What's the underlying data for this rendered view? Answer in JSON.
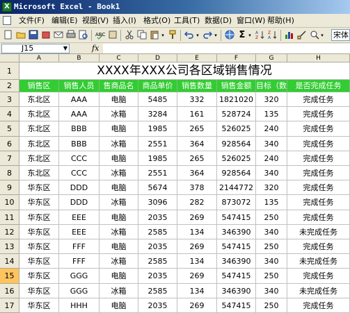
{
  "window": {
    "title": "Microsoft Excel - Book1"
  },
  "menu": [
    "文件(F)",
    "编辑(E)",
    "视图(V)",
    "插入(I)",
    "格式(O)",
    "工具(T)",
    "数据(D)",
    "窗口(W)",
    "帮助(H)"
  ],
  "toolbar": {
    "font_name": "宋体",
    "fx_label": "fx"
  },
  "formula_bar": {
    "name_box": "J15",
    "formula": ""
  },
  "columns": [
    "A",
    "B",
    "C",
    "D",
    "E",
    "F",
    "G",
    "H"
  ],
  "row_numbers": [
    "1",
    "2",
    "3",
    "4",
    "5",
    "6",
    "7",
    "8",
    "9",
    "10",
    "11",
    "12",
    "13",
    "14",
    "15",
    "16",
    "17"
  ],
  "sheet": {
    "title": "XXXX年XXX公司各区域销售情况",
    "headers": [
      "销售区",
      "销售人员",
      "售商品名",
      "商品单价",
      "销售数量",
      "销售金额",
      "目标（数",
      "是否完成任务"
    ],
    "rows": [
      [
        "东北区",
        "AAA",
        "电脑",
        "5485",
        "332",
        "1821020",
        "320",
        "完成任务"
      ],
      [
        "东北区",
        "AAA",
        "冰箱",
        "3284",
        "161",
        "528724",
        "135",
        "完成任务"
      ],
      [
        "东北区",
        "BBB",
        "电脑",
        "1985",
        "265",
        "526025",
        "240",
        "完成任务"
      ],
      [
        "东北区",
        "BBB",
        "冰箱",
        "2551",
        "364",
        "928564",
        "340",
        "完成任务"
      ],
      [
        "东北区",
        "CCC",
        "电脑",
        "1985",
        "265",
        "526025",
        "240",
        "完成任务"
      ],
      [
        "东北区",
        "CCC",
        "冰箱",
        "2551",
        "364",
        "928564",
        "340",
        "完成任务"
      ],
      [
        "华东区",
        "DDD",
        "电脑",
        "5674",
        "378",
        "2144772",
        "320",
        "完成任务"
      ],
      [
        "华东区",
        "DDD",
        "冰箱",
        "3096",
        "282",
        "873072",
        "135",
        "完成任务"
      ],
      [
        "华东区",
        "EEE",
        "电脑",
        "2035",
        "269",
        "547415",
        "250",
        "完成任务"
      ],
      [
        "华东区",
        "EEE",
        "冰箱",
        "2585",
        "134",
        "346390",
        "340",
        "未完成任务"
      ],
      [
        "华东区",
        "FFF",
        "电脑",
        "2035",
        "269",
        "547415",
        "250",
        "完成任务"
      ],
      [
        "华东区",
        "FFF",
        "冰箱",
        "2585",
        "134",
        "346390",
        "340",
        "未完成任务"
      ],
      [
        "华东区",
        "GGG",
        "电脑",
        "2035",
        "269",
        "547415",
        "250",
        "完成任务"
      ],
      [
        "华东区",
        "GGG",
        "冰箱",
        "2585",
        "134",
        "346390",
        "340",
        "未完成任务"
      ],
      [
        "华东区",
        "HHH",
        "电脑",
        "2035",
        "269",
        "547415",
        "250",
        "完成任务"
      ]
    ]
  },
  "active_row": "15",
  "colors": {
    "header_fill": "#33cc33",
    "header_text": "#ffffff",
    "active_row_header": "#ffc45e"
  }
}
